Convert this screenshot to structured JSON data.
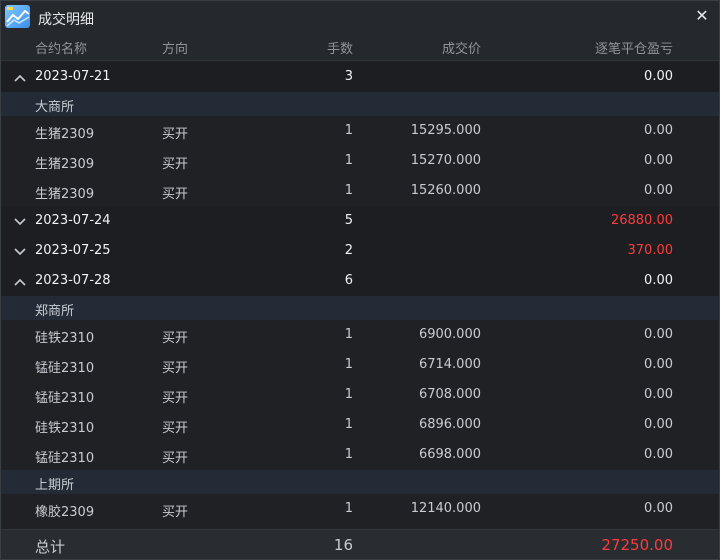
{
  "window": {
    "title": "成交明细",
    "close_glyph": "✕",
    "icon": "chart-line-icon"
  },
  "columns": {
    "contract": "合约名称",
    "direction": "方向",
    "qty": "手数",
    "price": "成交价",
    "pnl": "逐笔平仓盈亏"
  },
  "groups": [
    {
      "date": "2023-07-21",
      "qty": "3",
      "pnl": "0.00",
      "pnl_color": "white",
      "expanded": true,
      "exchanges": [
        {
          "name": "大商所",
          "trades": [
            {
              "contract": "生猪2309",
              "direction": "买开",
              "qty": "1",
              "price": "15295.000",
              "pnl": "0.00"
            },
            {
              "contract": "生猪2309",
              "direction": "买开",
              "qty": "1",
              "price": "15270.000",
              "pnl": "0.00"
            },
            {
              "contract": "生猪2309",
              "direction": "买开",
              "qty": "1",
              "price": "15260.000",
              "pnl": "0.00"
            }
          ]
        }
      ]
    },
    {
      "date": "2023-07-24",
      "qty": "5",
      "pnl": "26880.00",
      "pnl_color": "red",
      "expanded": false,
      "exchanges": []
    },
    {
      "date": "2023-07-25",
      "qty": "2",
      "pnl": "370.00",
      "pnl_color": "red",
      "expanded": false,
      "exchanges": []
    },
    {
      "date": "2023-07-28",
      "qty": "6",
      "pnl": "0.00",
      "pnl_color": "white",
      "expanded": true,
      "exchanges": [
        {
          "name": "郑商所",
          "trades": [
            {
              "contract": "硅铁2310",
              "direction": "买开",
              "qty": "1",
              "price": "6900.000",
              "pnl": "0.00"
            },
            {
              "contract": "锰硅2310",
              "direction": "买开",
              "qty": "1",
              "price": "6714.000",
              "pnl": "0.00"
            },
            {
              "contract": "锰硅2310",
              "direction": "买开",
              "qty": "1",
              "price": "6708.000",
              "pnl": "0.00"
            },
            {
              "contract": "硅铁2310",
              "direction": "买开",
              "qty": "1",
              "price": "6896.000",
              "pnl": "0.00"
            },
            {
              "contract": "锰硅2310",
              "direction": "买开",
              "qty": "1",
              "price": "6698.000",
              "pnl": "0.00"
            }
          ]
        },
        {
          "name": "上期所",
          "trades": [
            {
              "contract": "橡胶2309",
              "direction": "买开",
              "qty": "1",
              "price": "12140.000",
              "pnl": "0.00"
            }
          ]
        }
      ]
    }
  ],
  "footer": {
    "label": "总计",
    "qty": "16",
    "pnl": "27250.00"
  },
  "colors": {
    "red": "#ff3b3b",
    "white": "#f0f2f4",
    "exchange_bg": "#232c36"
  }
}
